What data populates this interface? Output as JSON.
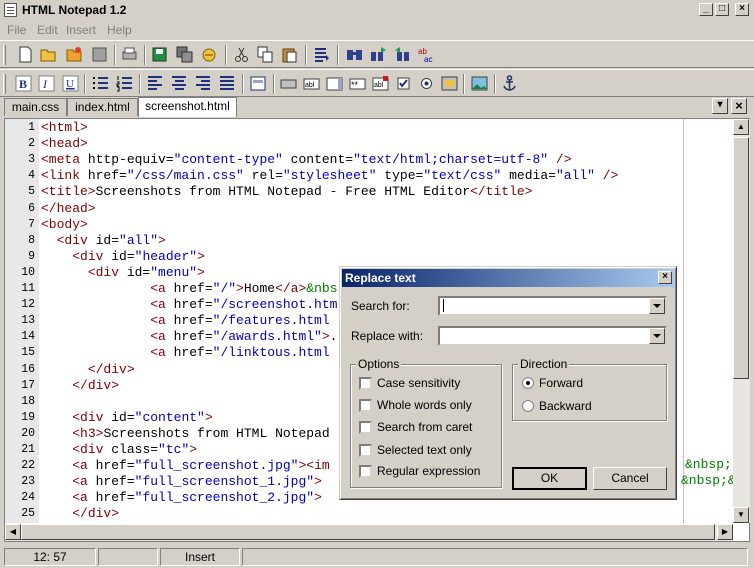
{
  "window": {
    "title": "HTML Notepad 1.2"
  },
  "menu": [
    "File",
    "Edit",
    "Insert",
    "Help"
  ],
  "tabs": [
    {
      "label": "main.css"
    },
    {
      "label": "index.html"
    },
    {
      "label": "screenshot.html",
      "active": true
    }
  ],
  "editor": {
    "line_numbers": [
      "1",
      "2",
      "3",
      "4",
      "5",
      "6",
      "7",
      "8",
      "9",
      "10",
      "11",
      "12",
      "13",
      "14",
      "15",
      "16",
      "17",
      "18",
      "19",
      "20",
      "21",
      "22",
      "23",
      "24",
      "25"
    ],
    "lines": [
      [
        [
          "t",
          "<html>"
        ]
      ],
      [
        [
          "t",
          "<head>"
        ]
      ],
      [
        [
          "t",
          "<meta "
        ],
        [
          "a",
          "http-equiv="
        ],
        [
          "v",
          "\"content-type\""
        ],
        [
          "a",
          " content="
        ],
        [
          "v",
          "\"text/html;charset=utf-8\""
        ],
        [
          "t",
          " />"
        ]
      ],
      [
        [
          "t",
          "<link "
        ],
        [
          "a",
          "href="
        ],
        [
          "v",
          "\"/css/main.css\""
        ],
        [
          "a",
          " rel="
        ],
        [
          "v",
          "\"stylesheet\""
        ],
        [
          "a",
          " type="
        ],
        [
          "v",
          "\"text/css\""
        ],
        [
          "a",
          " media="
        ],
        [
          "v",
          "\"all\""
        ],
        [
          "t",
          " />"
        ]
      ],
      [
        [
          "t",
          "<title>"
        ],
        [
          "a",
          "Screenshots from HTML Notepad - Free HTML Editor"
        ],
        [
          "t",
          "</title>"
        ]
      ],
      [
        [
          "t",
          "</head>"
        ]
      ],
      [
        [
          "t",
          "<body>"
        ]
      ],
      [
        [
          "a",
          "  "
        ],
        [
          "t",
          "<div "
        ],
        [
          "a",
          "id="
        ],
        [
          "v",
          "\"all\""
        ],
        [
          "t",
          ">"
        ]
      ],
      [
        [
          "a",
          "    "
        ],
        [
          "t",
          "<div "
        ],
        [
          "a",
          "id="
        ],
        [
          "v",
          "\"header\""
        ],
        [
          "t",
          ">"
        ]
      ],
      [
        [
          "a",
          "      "
        ],
        [
          "t",
          "<div "
        ],
        [
          "a",
          "id="
        ],
        [
          "v",
          "\"menu\""
        ],
        [
          "t",
          ">"
        ]
      ],
      [
        [
          "a",
          "              "
        ],
        [
          "t",
          "<a "
        ],
        [
          "a",
          "href="
        ],
        [
          "v",
          "\"/\""
        ],
        [
          "t",
          ">"
        ],
        [
          "a",
          "Home"
        ],
        [
          "t",
          "</a>"
        ],
        [
          "e",
          "&nbs"
        ]
      ],
      [
        [
          "a",
          "              "
        ],
        [
          "t",
          "<a "
        ],
        [
          "a",
          "href="
        ],
        [
          "v",
          "\"/screenshot.htm"
        ]
      ],
      [
        [
          "a",
          "              "
        ],
        [
          "t",
          "<a "
        ],
        [
          "a",
          "href="
        ],
        [
          "v",
          "\"/features.html"
        ]
      ],
      [
        [
          "a",
          "              "
        ],
        [
          "t",
          "<a "
        ],
        [
          "a",
          "href="
        ],
        [
          "v",
          "\"/awards.html\""
        ],
        [
          "t",
          ">"
        ],
        [
          "a",
          "."
        ]
      ],
      [
        [
          "a",
          "              "
        ],
        [
          "t",
          "<a "
        ],
        [
          "a",
          "href="
        ],
        [
          "v",
          "\"/linktous.html"
        ]
      ],
      [
        [
          "a",
          "      "
        ],
        [
          "t",
          "</div>"
        ]
      ],
      [
        [
          "a",
          "    "
        ],
        [
          "t",
          "</div>"
        ]
      ],
      [],
      [
        [
          "a",
          "    "
        ],
        [
          "t",
          "<div "
        ],
        [
          "a",
          "id="
        ],
        [
          "v",
          "\"content\""
        ],
        [
          "t",
          ">"
        ]
      ],
      [
        [
          "a",
          "    "
        ],
        [
          "t",
          "<h3>"
        ],
        [
          "a",
          "Screenshots from HTML Notepad"
        ]
      ],
      [
        [
          "a",
          "    "
        ],
        [
          "t",
          "<div "
        ],
        [
          "a",
          "class="
        ],
        [
          "v",
          "\"tc\""
        ],
        [
          "t",
          ">"
        ]
      ],
      [
        [
          "a",
          "    "
        ],
        [
          "t",
          "<a "
        ],
        [
          "a",
          "href="
        ],
        [
          "v",
          "\"full_screenshot.jpg\""
        ],
        [
          "t",
          "><im"
        ]
      ],
      [
        [
          "a",
          "    "
        ],
        [
          "t",
          "<a "
        ],
        [
          "a",
          "href="
        ],
        [
          "v",
          "\"full_screenshot_1.jpg\""
        ],
        [
          "t",
          ">"
        ]
      ],
      [
        [
          "a",
          "    "
        ],
        [
          "t",
          "<a "
        ],
        [
          "a",
          "href="
        ],
        [
          "v",
          "\"full_screenshot_2.jpg\""
        ],
        [
          "t",
          ">"
        ]
      ],
      [
        [
          "a",
          "    "
        ],
        [
          "t",
          "</div>"
        ]
      ]
    ],
    "right_fragments": [
      "&nbsp;",
      "&nbsp;&n"
    ]
  },
  "status": {
    "position": "12: 57",
    "mode": "Insert"
  },
  "dialog": {
    "title": "Replace text",
    "search_label": "Search for:",
    "search_value": "",
    "replace_label": "Replace with:",
    "replace_value": "",
    "options_label": "Options",
    "options": [
      {
        "label": "Case sensitivity",
        "checked": false
      },
      {
        "label": "Whole words only",
        "checked": false
      },
      {
        "label": "Search from caret",
        "checked": false
      },
      {
        "label": "Selected text only",
        "checked": false
      },
      {
        "label": "Regular expression",
        "checked": false
      }
    ],
    "direction_label": "Direction",
    "directions": [
      {
        "label": "Forward",
        "selected": true
      },
      {
        "label": "Backward",
        "selected": false
      }
    ],
    "ok_label": "OK",
    "cancel_label": "Cancel"
  },
  "toolbar1_icons": [
    "new-file-icon",
    "open-folder-icon",
    "recent-folder-icon",
    "close-file-icon",
    "print-icon",
    "save-icon",
    "save-all-icon",
    "wizard-icon",
    "cut-icon",
    "copy-icon",
    "paste-icon",
    "format-icon",
    "find-icon",
    "find-next-icon",
    "find-prev-icon",
    "spellcheck-icon"
  ],
  "toolbar2_icons": [
    "bold-icon",
    "italic-icon",
    "underline-icon",
    "bullet-list-icon",
    "numbered-list-icon",
    "align-left-icon",
    "align-center-icon",
    "align-right-icon",
    "align-justify-icon",
    "form-icon",
    "button-icon",
    "textfield-icon",
    "textarea-icon",
    "password-icon",
    "select-icon",
    "checkbox-icon",
    "radio-icon",
    "image-button-icon",
    "image-icon",
    "anchor-icon"
  ],
  "colors": {
    "tag": "#800000",
    "value": "#0000c0",
    "entity": "#008000",
    "titlebar": "#0a246a"
  }
}
